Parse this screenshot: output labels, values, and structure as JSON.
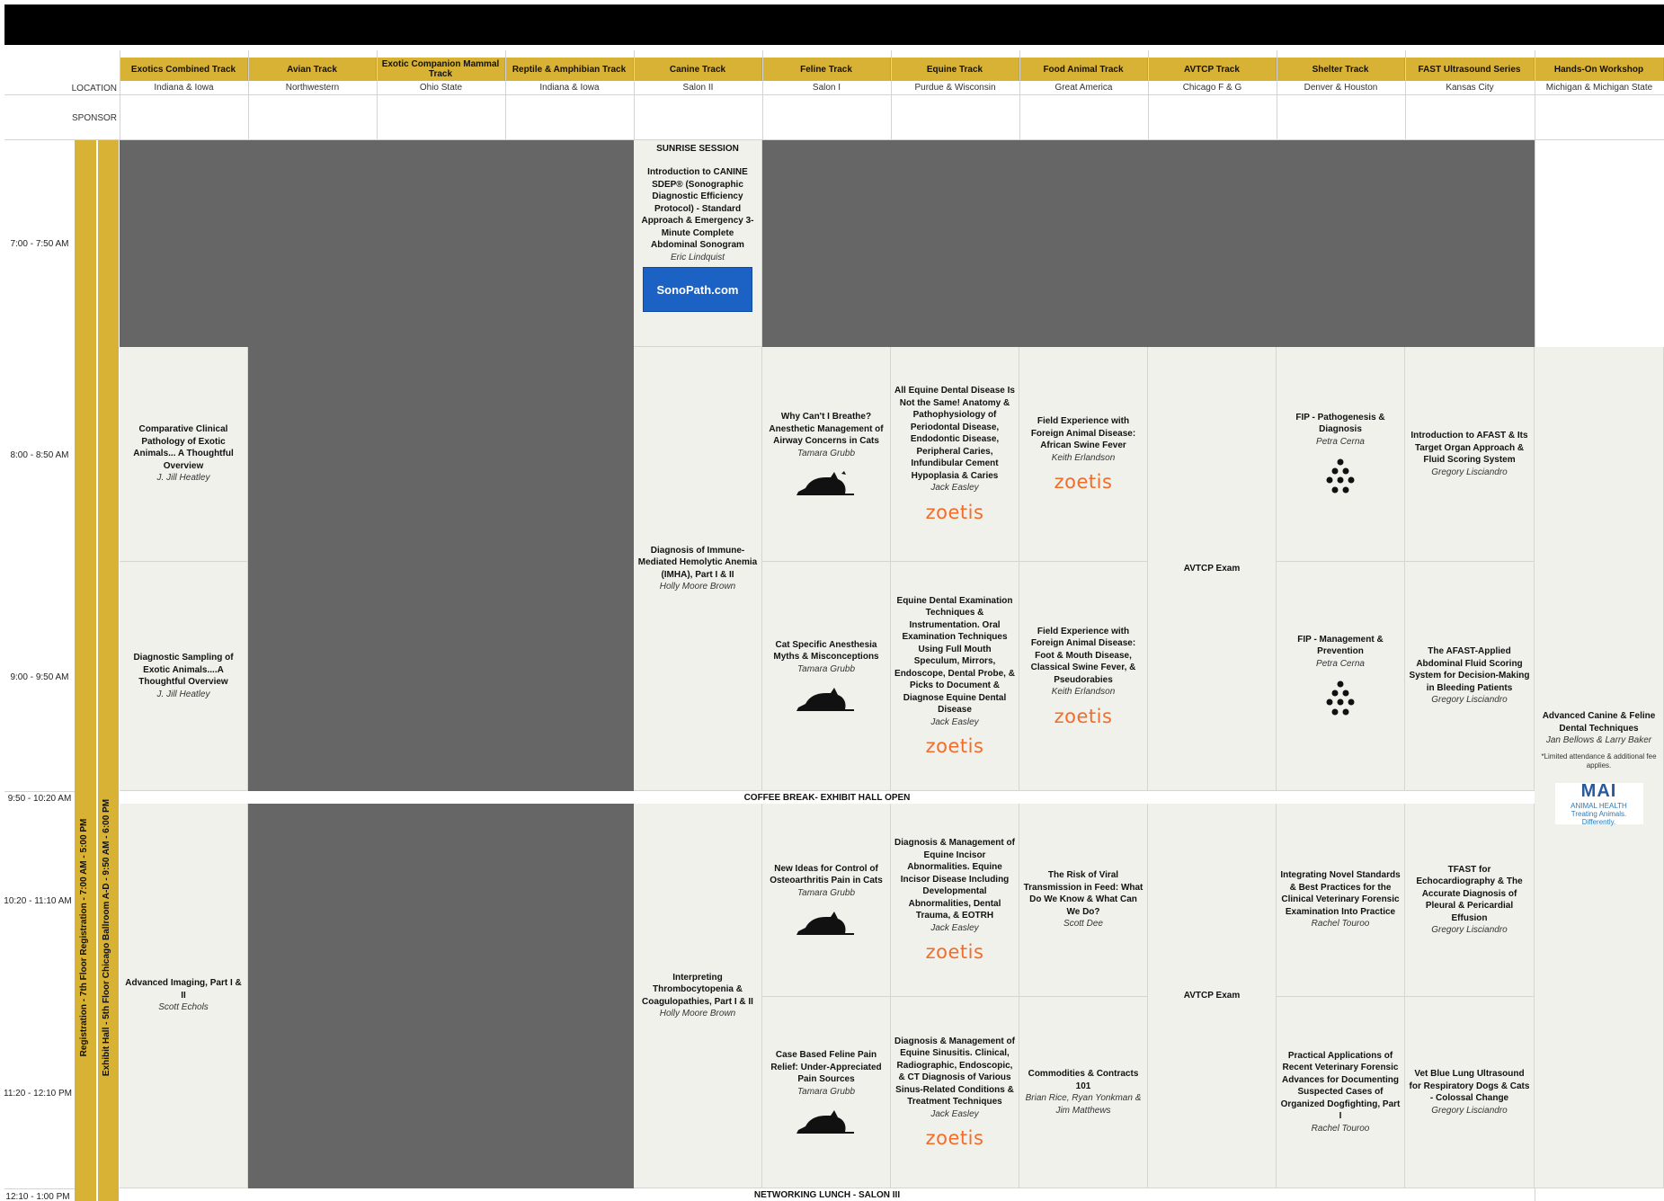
{
  "header": {
    "location_label": "LOCATION",
    "sponsor_label": "SPONSOR"
  },
  "tracks": [
    {
      "name": "Exotics Combined Track",
      "location": "Indiana & Iowa"
    },
    {
      "name": "Avian Track",
      "location": "Northwestern"
    },
    {
      "name": "Exotic Companion Mammal Track",
      "location": "Ohio State"
    },
    {
      "name": "Reptile & Amphibian Track",
      "location": "Indiana & Iowa"
    },
    {
      "name": "Canine Track",
      "location": "Salon II"
    },
    {
      "name": "Feline Track",
      "location": "Salon I"
    },
    {
      "name": "Equine Track",
      "location": "Purdue & Wisconsin"
    },
    {
      "name": "Food Animal Track",
      "location": "Great America"
    },
    {
      "name": "AVTCP Track",
      "location": "Chicago F & G"
    },
    {
      "name": "Shelter Track",
      "location": "Denver & Houston"
    },
    {
      "name": "FAST Ultrasound Series",
      "location": "Kansas City"
    },
    {
      "name": "Hands-On Workshop",
      "location": "Michigan & Michigan State"
    }
  ],
  "times": [
    "7:00 - 7:50 AM",
    "8:00 - 8:50 AM",
    "9:00 - 9:50 AM",
    "9:50 - 10:20 AM",
    "10:20 - 11:10 AM",
    "11:20 - 12:10 PM",
    "12:10 - 1:00 PM"
  ],
  "vertical_bands": {
    "registration": "Registration - 7th Floor Registration - 7:00 AM - 5:00 PM",
    "exhibit_hall": "Exhibit Hall - 5th Floor Chicago Ballroom A-D - 9:50 AM - 6:00 PM"
  },
  "breaks": {
    "coffee": "COFFEE BREAK- EXHIBIT HALL OPEN",
    "lunch": "NETWORKING LUNCH - SALON III"
  },
  "sessions": {
    "canine_sunrise": {
      "label": "SUNRISE SESSION",
      "title": "Introduction to CANINE SDEP® (Sonographic Diagnostic Efficiency Protocol) - Standard Approach & Emergency 3-Minute Complete Abdominal Sonogram",
      "speaker": "Eric Lindquist",
      "sponsor_logo": "SonoPath.com"
    },
    "exotics_1": {
      "title": "Comparative Clinical Pathology of Exotic Animals... A Thoughtful Overview",
      "speaker": "J. Jill Heatley"
    },
    "exotics_2": {
      "title": "Diagnostic Sampling of Exotic Animals....A Thoughtful Overview",
      "speaker": "J. Jill Heatley"
    },
    "exotics_3": {
      "title": "Advanced Imaging, Part I & II",
      "speaker": "Scott Echols"
    },
    "canine_1": {
      "title": "Diagnosis of Immune-Mediated Hemolytic Anemia (IMHA), Part I & II",
      "speaker": "Holly Moore Brown"
    },
    "canine_2": {
      "title": "Interpreting Thrombocytopenia & Coagulopathies, Part I & II",
      "speaker": "Holly Moore Brown"
    },
    "feline_1": {
      "title": "Why Can't I Breathe? Anesthetic Management of Airway Concerns in Cats",
      "speaker": "Tamara Grubb"
    },
    "feline_2": {
      "title": "Cat Specific Anesthesia Myths & Misconceptions",
      "speaker": "Tamara Grubb"
    },
    "feline_3": {
      "title": "New Ideas for Control of Osteoarthritis Pain in Cats",
      "speaker": "Tamara Grubb"
    },
    "feline_4": {
      "title": "Case Based Feline Pain Relief: Under-Appreciated Pain Sources",
      "speaker": "Tamara Grubb"
    },
    "equine_1": {
      "title": "All Equine Dental Disease Is Not the Same! Anatomy & Pathophysiology of Periodontal Disease, Endodontic Disease, Peripheral Caries, Infundibular Cement Hypoplasia & Caries",
      "speaker": "Jack Easley"
    },
    "equine_2": {
      "title": "Equine Dental Examination Techniques & Instrumentation. Oral Examination Techniques Using Full Mouth Speculum, Mirrors, Endoscope, Dental Probe, & Picks to Document & Diagnose Equine Dental Disease",
      "speaker": "Jack Easley"
    },
    "equine_3": {
      "title": "Diagnosis & Management of Equine Incisor Abnormalities. Equine Incisor Disease Including Developmental Abnormalities, Dental Trauma, & EOTRH",
      "speaker": "Jack Easley"
    },
    "equine_4": {
      "title": "Diagnosis & Management of Equine Sinusitis. Clinical, Radiographic, Endoscopic, & CT Diagnosis of Various Sinus-Related Conditions & Treatment Techniques",
      "speaker": "Jack Easley"
    },
    "food_1": {
      "title": "Field Experience with Foreign Animal Disease: African Swine Fever",
      "speaker": "Keith Erlandson"
    },
    "food_2": {
      "title": "Field Experience with Foreign Animal Disease: Foot & Mouth Disease, Classical Swine Fever, & Pseudorabies",
      "speaker": "Keith Erlandson"
    },
    "food_3": {
      "title": "The Risk of Viral Transmission in Feed: What Do We Know & What Can We Do?",
      "speaker": "Scott Dee"
    },
    "food_4": {
      "title": "Commodities & Contracts 101",
      "speaker": "Brian Rice, Ryan Yonkman & Jim Matthews"
    },
    "avtcp_1": {
      "title": "AVTCP Exam"
    },
    "avtcp_2": {
      "title": "AVTCP Exam"
    },
    "shelter_1": {
      "title": "FIP - Pathogenesis & Diagnosis",
      "speaker": "Petra Cerna"
    },
    "shelter_2": {
      "title": "FIP - Management & Prevention",
      "speaker": "Petra Cerna"
    },
    "shelter_3": {
      "title": "Integrating Novel Standards & Best Practices for the Clinical Veterinary Forensic Examination Into Practice",
      "speaker": "Rachel Touroo"
    },
    "shelter_4": {
      "title": "Practical Applications of Recent Veterinary Forensic Advances for Documenting Suspected Cases of Organized Dogfighting, Part I",
      "speaker": "Rachel Touroo"
    },
    "fast_1": {
      "title": "Introduction to AFAST & Its Target Organ Approach & Fluid Scoring System",
      "speaker": "Gregory Lisciandro"
    },
    "fast_2": {
      "title": "The AFAST-Applied Abdominal Fluid Scoring System for Decision-Making in Bleeding Patients",
      "speaker": "Gregory Lisciandro"
    },
    "fast_3": {
      "title": "TFAST for Echocardiography & The Accurate Diagnosis of Pleural & Pericardial Effusion",
      "speaker": "Gregory Lisciandro"
    },
    "fast_4": {
      "title": "Vet Blue Lung Ultrasound for Respiratory Dogs & Cats - Colossal Change",
      "speaker": "Gregory Lisciandro"
    },
    "workshop_1": {
      "title": "Advanced Canine & Feline Dental Techniques",
      "speaker": "Jan Bellows & Larry Baker",
      "note": "*Limited attendance & additional fee applies.",
      "sponsor_logo": "MAI",
      "sponsor_sub": "ANIMAL HEALTH",
      "sponsor_tagline": "Treating Animals. Differently."
    }
  },
  "sponsor_logos": {
    "zoetis": "zoetis",
    "feline_logo": "cat-practitioners-logo",
    "shelter_logo": "dot-triangle-logo"
  },
  "colors": {
    "header_gold": "#d8b235",
    "unavailable": "#666666",
    "session_bg": "#f1f1ec",
    "zoetis_orange": "#f26c2a"
  }
}
